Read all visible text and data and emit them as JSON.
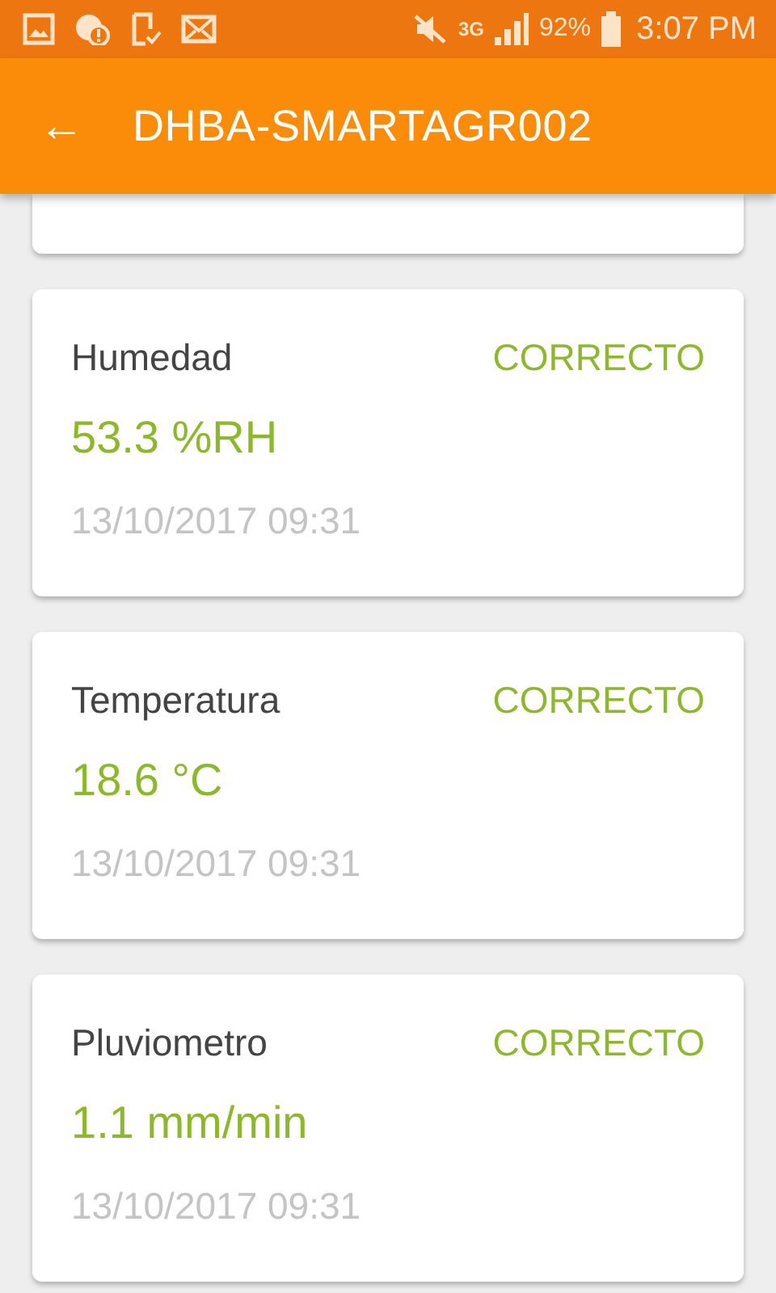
{
  "status_bar": {
    "network": "3G",
    "battery": "92%",
    "time": "3:07 PM"
  },
  "app_bar": {
    "back_icon": "←",
    "title": "DHBA-SMARTAGR002"
  },
  "cards": [
    {
      "kind": "partial"
    },
    {
      "kind": "sensor",
      "name": "Humedad",
      "status": "CORRECTO",
      "value": "53.3 %RH",
      "timestamp": "13/10/2017 09:31"
    },
    {
      "kind": "sensor",
      "name": "Temperatura",
      "status": "CORRECTO",
      "value": "18.6 °C",
      "timestamp": "13/10/2017 09:31"
    },
    {
      "kind": "sensor",
      "name": "Pluviometro",
      "status": "CORRECTO",
      "value": "1.1 mm/min",
      "timestamp": "13/10/2017 09:31"
    }
  ]
}
